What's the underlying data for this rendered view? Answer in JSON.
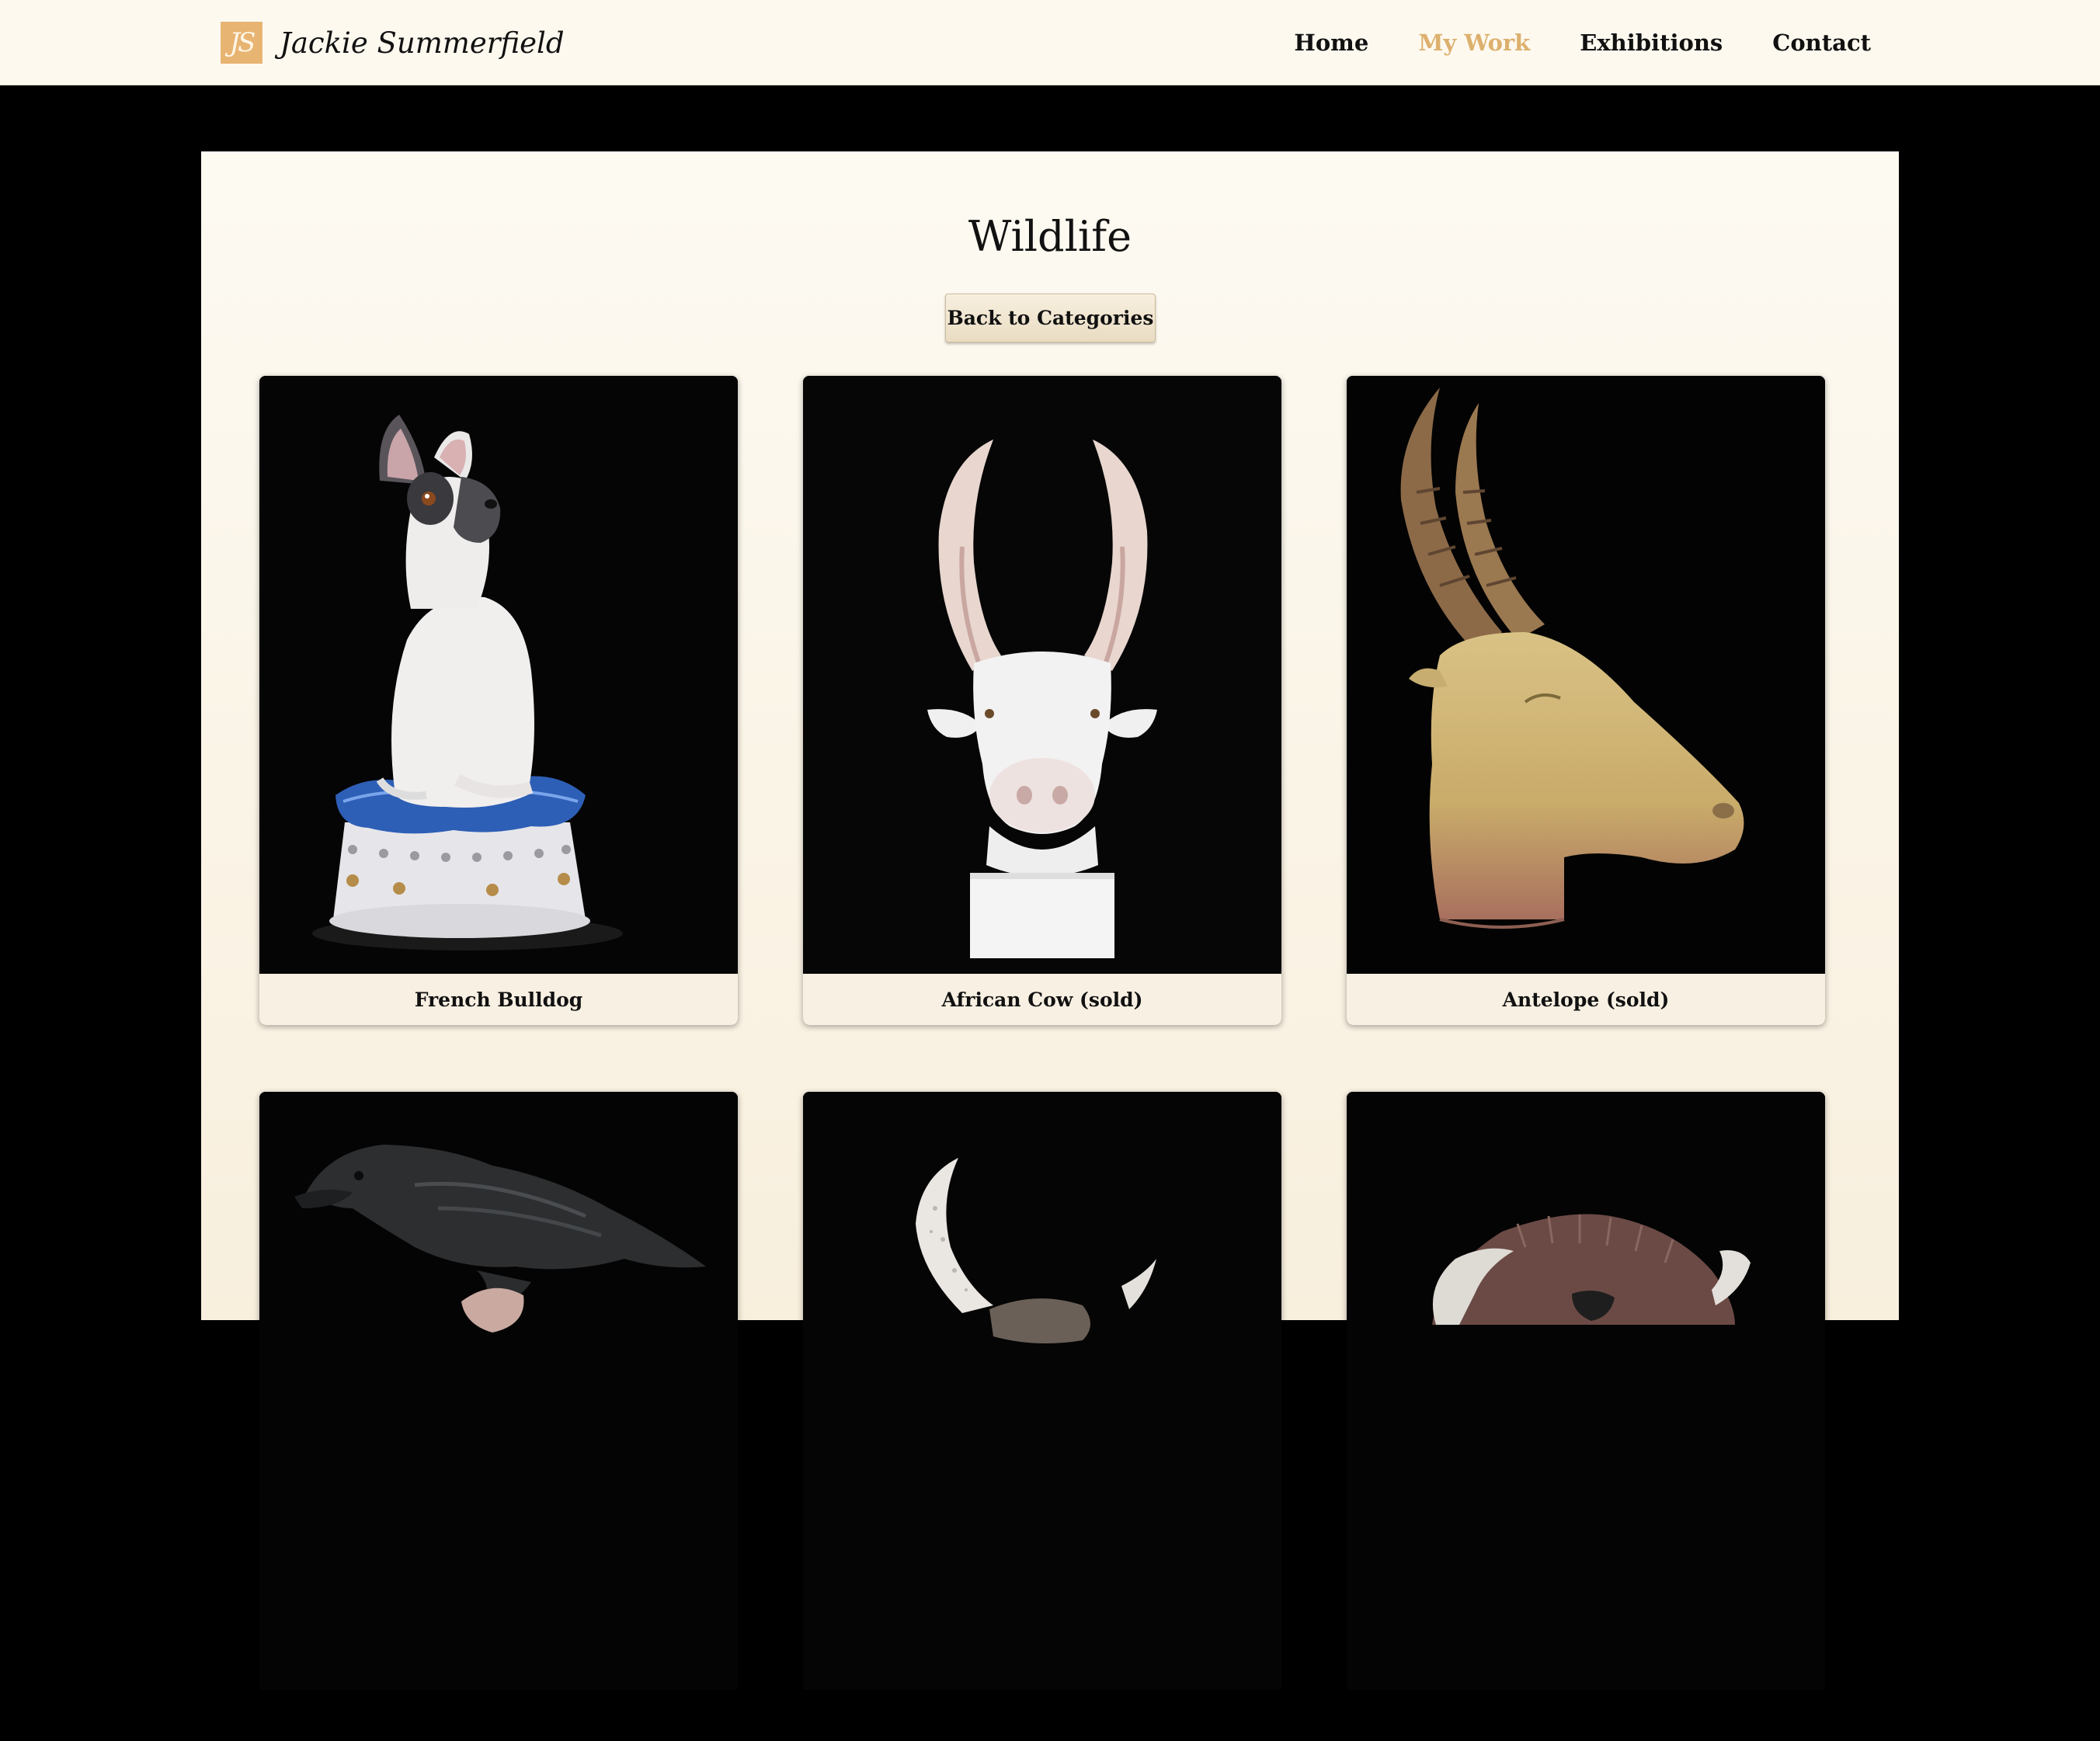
{
  "header": {
    "logo_mark": "JS",
    "logo_text": "Jackie Summerfield",
    "nav": [
      {
        "label": "Home",
        "active": false
      },
      {
        "label": "My Work",
        "active": true
      },
      {
        "label": "Exhibitions",
        "active": false
      },
      {
        "label": "Contact",
        "active": false
      }
    ]
  },
  "main": {
    "title": "Wildlife",
    "back_button": "Back to Categories",
    "items": [
      {
        "caption": "French Bulldog",
        "icon": "french-bulldog-sculpture-image"
      },
      {
        "caption": "African Cow (sold)",
        "icon": "african-cow-sculpture-image"
      },
      {
        "caption": "Antelope (sold)",
        "icon": "antelope-sculpture-image"
      },
      {
        "caption": "",
        "icon": "raven-sculpture-image"
      },
      {
        "caption": "",
        "icon": "horned-buffalo-sculpture-image"
      },
      {
        "caption": "",
        "icon": "bison-sculpture-image"
      }
    ]
  },
  "colors": {
    "accent": "#ddb06e",
    "logo_bg": "#e8b472",
    "header_bg": "#fdf9ef",
    "page_bg": "#000000",
    "panel_bg": "#fbf5e8"
  }
}
